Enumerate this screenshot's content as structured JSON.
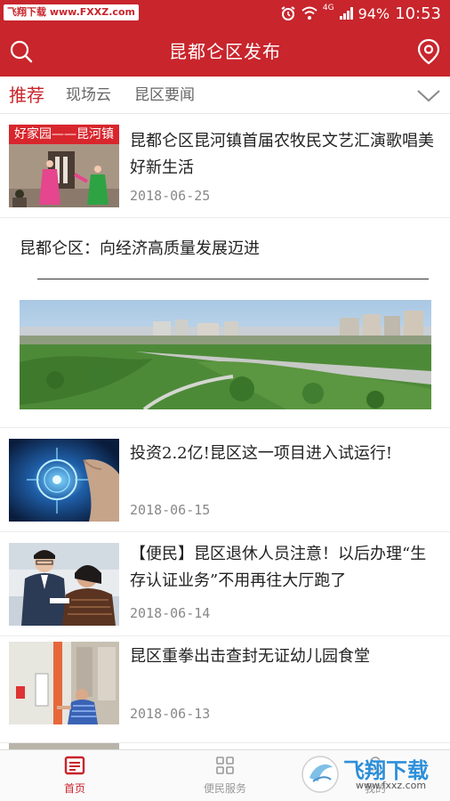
{
  "status": {
    "watermark": "飞翔下载 www.FXXZ.com",
    "network": "4G",
    "battery": "94%",
    "time": "10:53"
  },
  "header": {
    "title": "昆都仑区发布",
    "search_icon": "search-icon",
    "location_icon": "location-pin-icon"
  },
  "tabs": [
    {
      "label": "推荐",
      "active": true
    },
    {
      "label": "现场云",
      "active": false
    },
    {
      "label": "昆区要闻",
      "active": false
    }
  ],
  "news": [
    {
      "headline": "昆都仑区昆河镇首届农牧民文艺汇演歌唱美好新生活",
      "date": "2018-06-25",
      "thumb_text": "好家园——昆河镇"
    },
    {
      "headline": "投资2.2亿!昆区这一项目进入试运行!",
      "date": "2018-06-15"
    },
    {
      "headline": "【便民】昆区退休人员注意！以后办理“生存认证业务”不用再往大厅跑了",
      "date": "2018-06-14"
    },
    {
      "headline": "昆区重拳出击查封无证幼儿园食堂",
      "date": "2018-06-13"
    }
  ],
  "feature": {
    "title": "昆都仑区：向经济高质量发展迈进"
  },
  "bottom_nav": [
    {
      "label": "首页",
      "active": true
    },
    {
      "label": "便民服务",
      "active": false
    },
    {
      "label": "我的",
      "active": false
    }
  ],
  "watermark_bottom": {
    "brand": "飞翔下载",
    "url": "www.fxxz.com"
  },
  "colors": {
    "brand_red": "#c8252c",
    "text": "#222222",
    "muted": "#888888"
  }
}
